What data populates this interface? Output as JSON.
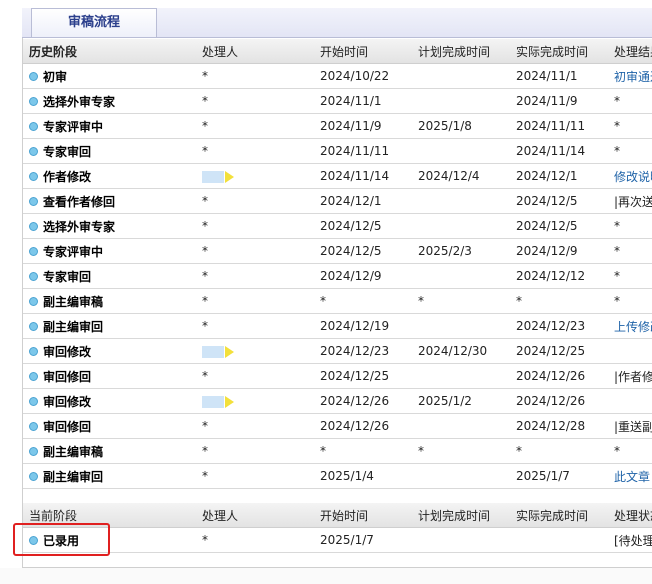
{
  "tab": {
    "label": "审稿流程"
  },
  "history": {
    "headers": [
      "历史阶段",
      "处理人",
      "开始时间",
      "计划完成时间",
      "实际完成时间",
      "处理结果"
    ],
    "rows": [
      {
        "stage": "初审",
        "handler": "*",
        "start": "2024/10/22",
        "planned": "",
        "actual": "2024/11/1",
        "result": "初审通过",
        "result_link": true
      },
      {
        "stage": "选择外审专家",
        "handler": "*",
        "start": "2024/11/1",
        "planned": "",
        "actual": "2024/11/9",
        "result": "*",
        "result_link": false
      },
      {
        "stage": "专家评审中",
        "handler": "*",
        "start": "2024/11/9",
        "planned": "2025/1/8",
        "actual": "2024/11/11",
        "result": "*",
        "result_link": false
      },
      {
        "stage": "专家审回",
        "handler": "*",
        "start": "2024/11/11",
        "planned": "",
        "actual": "2024/11/14",
        "result": "*",
        "result_link": false
      },
      {
        "stage": "作者修改",
        "handler": "",
        "handler_icon": "avatar-arrow",
        "start": "2024/11/14",
        "planned": "2024/12/4",
        "actual": "2024/12/1",
        "result": "修改说明",
        "result_link": true
      },
      {
        "stage": "查看作者修回",
        "handler": "*",
        "start": "2024/12/1",
        "planned": "",
        "actual": "2024/12/5",
        "result": "|再次送",
        "result_link": false
      },
      {
        "stage": "选择外审专家",
        "handler": "*",
        "start": "2024/12/5",
        "planned": "",
        "actual": "2024/12/5",
        "result": "*",
        "result_link": false
      },
      {
        "stage": "专家评审中",
        "handler": "*",
        "start": "2024/12/5",
        "planned": "2025/2/3",
        "actual": "2024/12/9",
        "result": "*",
        "result_link": false
      },
      {
        "stage": "专家审回",
        "handler": "*",
        "start": "2024/12/9",
        "planned": "",
        "actual": "2024/12/12",
        "result": "*",
        "result_link": false
      },
      {
        "stage": "副主编审稿",
        "handler": "*",
        "start": "*",
        "planned": "*",
        "actual": "*",
        "result": "*",
        "result_link": false
      },
      {
        "stage": "副主编审回",
        "handler": "*",
        "start": "2024/12/19",
        "planned": "",
        "actual": "2024/12/23",
        "result": "上传修改",
        "result_link": true
      },
      {
        "stage": "审回修改",
        "handler": "",
        "handler_icon": "avatar-arrow",
        "start": "2024/12/23",
        "planned": "2024/12/30",
        "actual": "2024/12/25",
        "result": "",
        "result_link": false
      },
      {
        "stage": "审回修回",
        "handler": "*",
        "start": "2024/12/25",
        "planned": "",
        "actual": "2024/12/26",
        "result": "|作者修",
        "result_link": false
      },
      {
        "stage": "审回修改",
        "handler": "",
        "handler_icon": "avatar-arrow",
        "start": "2024/12/26",
        "planned": "2025/1/2",
        "actual": "2024/12/26",
        "result": "",
        "result_link": false
      },
      {
        "stage": "审回修回",
        "handler": "*",
        "start": "2024/12/26",
        "planned": "",
        "actual": "2024/12/28",
        "result": "|重送副",
        "result_link": false
      },
      {
        "stage": "副主编审稿",
        "handler": "*",
        "start": "*",
        "planned": "*",
        "actual": "*",
        "result": "*",
        "result_link": false
      },
      {
        "stage": "副主编审回",
        "handler": "*",
        "start": "2025/1/4",
        "planned": "",
        "actual": "2025/1/7",
        "result": "此文章",
        "result_link": true
      }
    ]
  },
  "current": {
    "headers": [
      "当前阶段",
      "处理人",
      "开始时间",
      "计划完成时间",
      "实际完成时间",
      "处理状态"
    ],
    "rows": [
      {
        "stage": "已录用",
        "handler": "*",
        "start": "2025/1/7",
        "planned": "",
        "actual": "",
        "result": "[待处理",
        "result_link": false
      }
    ]
  }
}
